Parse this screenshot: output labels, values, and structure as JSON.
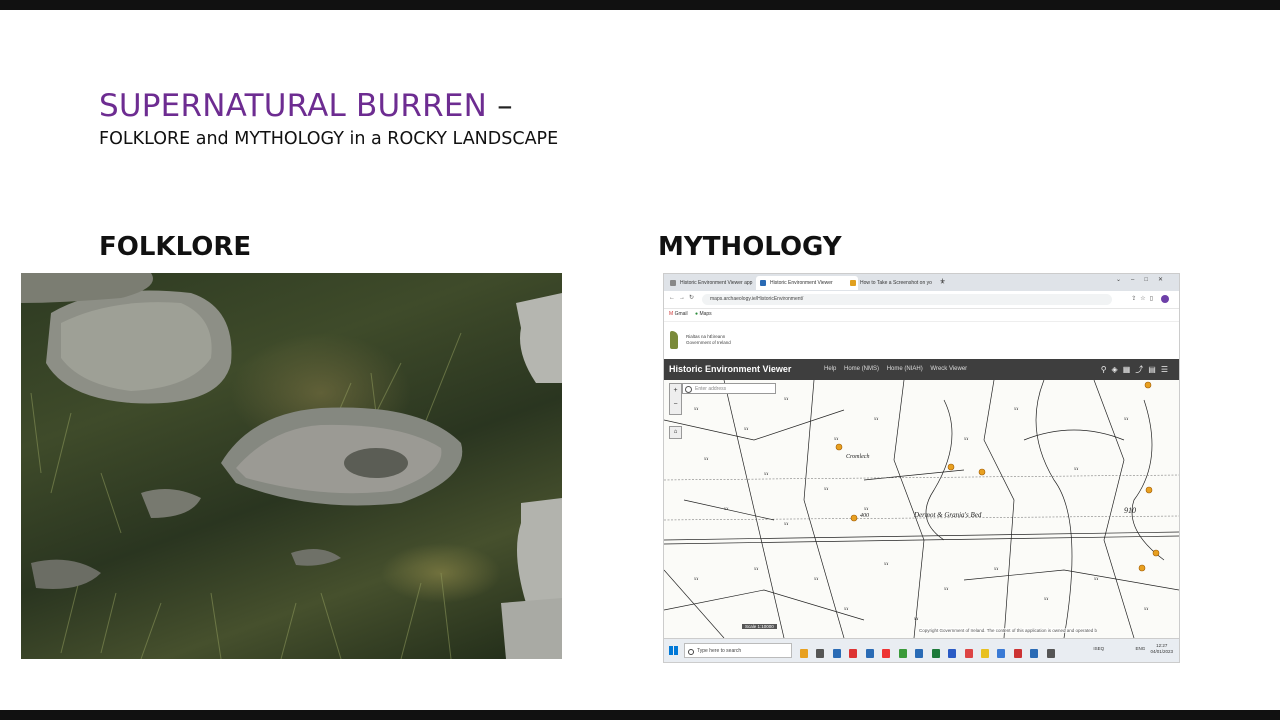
{
  "slide": {
    "title_main": "SUPERNATURAL BURREN",
    "title_dash": "–",
    "subtitle": "FOLKLORE and MYTHOLOGY in a ROCKY LANDSCAPE",
    "heading_left": "FOLKLORE",
    "heading_right": "MYTHOLOGY"
  },
  "colors": {
    "title_purple": "#6d2c91",
    "hev_bar": "#3e3e3e",
    "map_marker": "#e8a020"
  },
  "browser": {
    "tabs": [
      {
        "label": "Historic Environment Viewer app"
      },
      {
        "label": "Historic Environment Viewer"
      },
      {
        "label": "How to Take a Screenshot on yo"
      }
    ],
    "url": "maps.archaeology.ie/HistoricEnvironment/",
    "bookmarks": [
      "Gmail",
      "Maps"
    ],
    "gov_line1": "Rialtas na hÉireann",
    "gov_line2": "Government of Ireland"
  },
  "viewer": {
    "title": "Historic Environment Viewer",
    "nav": [
      "Help",
      "Home (NMS)",
      "Home (NIAH)",
      "Wreck Viewer"
    ],
    "search_placeholder": "Enter address",
    "map_labels": {
      "cromlech": "Cromlech",
      "bed": "Dermot & Grania's Bed",
      "elev1": "400",
      "elev2": "910"
    },
    "scale_text": "Scale 1:10000",
    "copyright": "Copyright Government of Ireland. The content of this application is owned and operated b"
  },
  "taskbar": {
    "search_placeholder": "Type here to search",
    "tray_lang": "ENG",
    "tray_time": "12:27",
    "tray_date": "04/01/2023",
    "tray_label": "ISEQ"
  }
}
